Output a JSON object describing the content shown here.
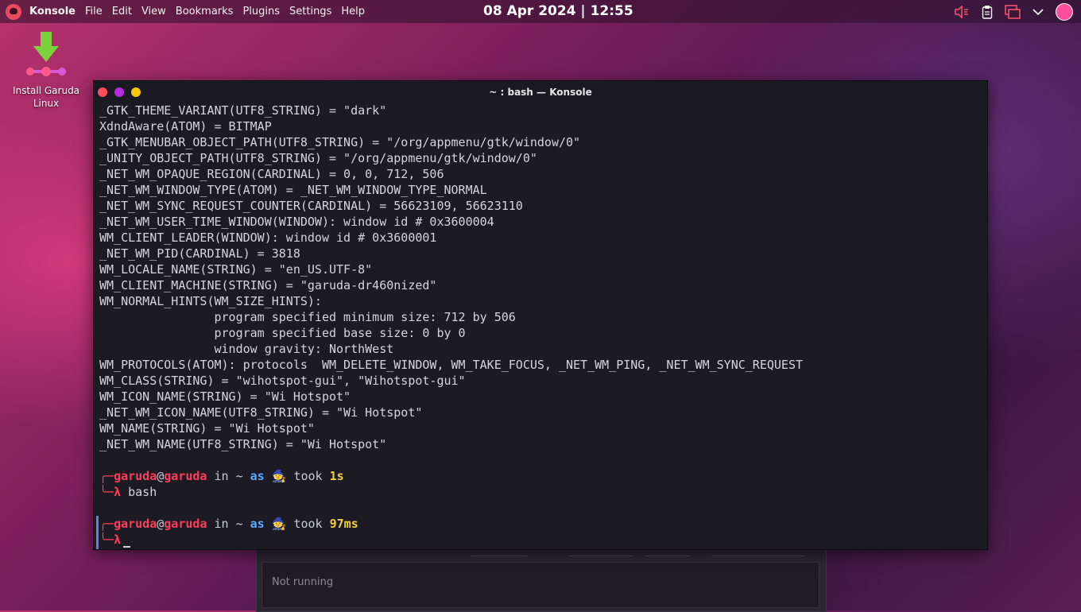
{
  "panel": {
    "app_name": "Konsole",
    "menu": [
      "File",
      "Edit",
      "View",
      "Bookmarks",
      "Plugins",
      "Settings",
      "Help"
    ],
    "clock": "08 Apr 2024 | 12:55",
    "tray_icons": [
      "audio-icon",
      "clipboard-icon",
      "network-icon",
      "chevron-down-icon",
      "user-avatar"
    ]
  },
  "desktop": {
    "installer": {
      "label_line1": "Install Garuda",
      "label_line2": "Linux",
      "icon": "installer-icon"
    }
  },
  "window": {
    "title": "~ : bash — Konsole"
  },
  "terminal": {
    "lines": [
      "_GTK_THEME_VARIANT(UTF8_STRING) = \"dark\"",
      "XdndAware(ATOM) = BITMAP",
      "_GTK_MENUBAR_OBJECT_PATH(UTF8_STRING) = \"/org/appmenu/gtk/window/0\"",
      "_UNITY_OBJECT_PATH(UTF8_STRING) = \"/org/appmenu/gtk/window/0\"",
      "_NET_WM_OPAQUE_REGION(CARDINAL) = 0, 0, 712, 506",
      "_NET_WM_WINDOW_TYPE(ATOM) = _NET_WM_WINDOW_TYPE_NORMAL",
      "_NET_WM_SYNC_REQUEST_COUNTER(CARDINAL) = 56623109, 56623110",
      "_NET_WM_USER_TIME_WINDOW(WINDOW): window id # 0x3600004",
      "WM_CLIENT_LEADER(WINDOW): window id # 0x3600001",
      "_NET_WM_PID(CARDINAL) = 3818",
      "WM_LOCALE_NAME(STRING) = \"en_US.UTF-8\"",
      "WM_CLIENT_MACHINE(STRING) = \"garuda-dr460nized\"",
      "WM_NORMAL_HINTS(WM_SIZE_HINTS):",
      "                program specified minimum size: 712 by 506",
      "                program specified base size: 0 by 0",
      "                window gravity: NorthWest",
      "WM_PROTOCOLS(ATOM): protocols  WM_DELETE_WINDOW, WM_TAKE_FOCUS, _NET_WM_PING, _NET_WM_SYNC_REQUEST",
      "WM_CLASS(STRING) = \"wihotspot-gui\", \"Wihotspot-gui\"",
      "WM_ICON_NAME(STRING) = \"Wi Hotspot\"",
      "_NET_WM_ICON_NAME(UTF8_STRING) = \"Wi Hotspot\"",
      "WM_NAME(STRING) = \"Wi Hotspot\"",
      "_NET_WM_NAME(UTF8_STRING) = \"Wi Hotspot\""
    ],
    "prompts": [
      {
        "user": "garuda",
        "at": "@",
        "host": "garuda",
        "in": "in",
        "path": "~",
        "as": "as",
        "emoji": "🧙",
        "took": "took",
        "duration": "1s",
        "lambda": "λ",
        "command": "bash"
      },
      {
        "user": "garuda",
        "at": "@",
        "host": "garuda",
        "in": "in",
        "path": "~",
        "as": "as",
        "emoji": "🧙",
        "took": "took",
        "duration": "97ms",
        "lambda": "λ",
        "command": ""
      }
    ]
  },
  "background_window": {
    "status": "Not running"
  }
}
